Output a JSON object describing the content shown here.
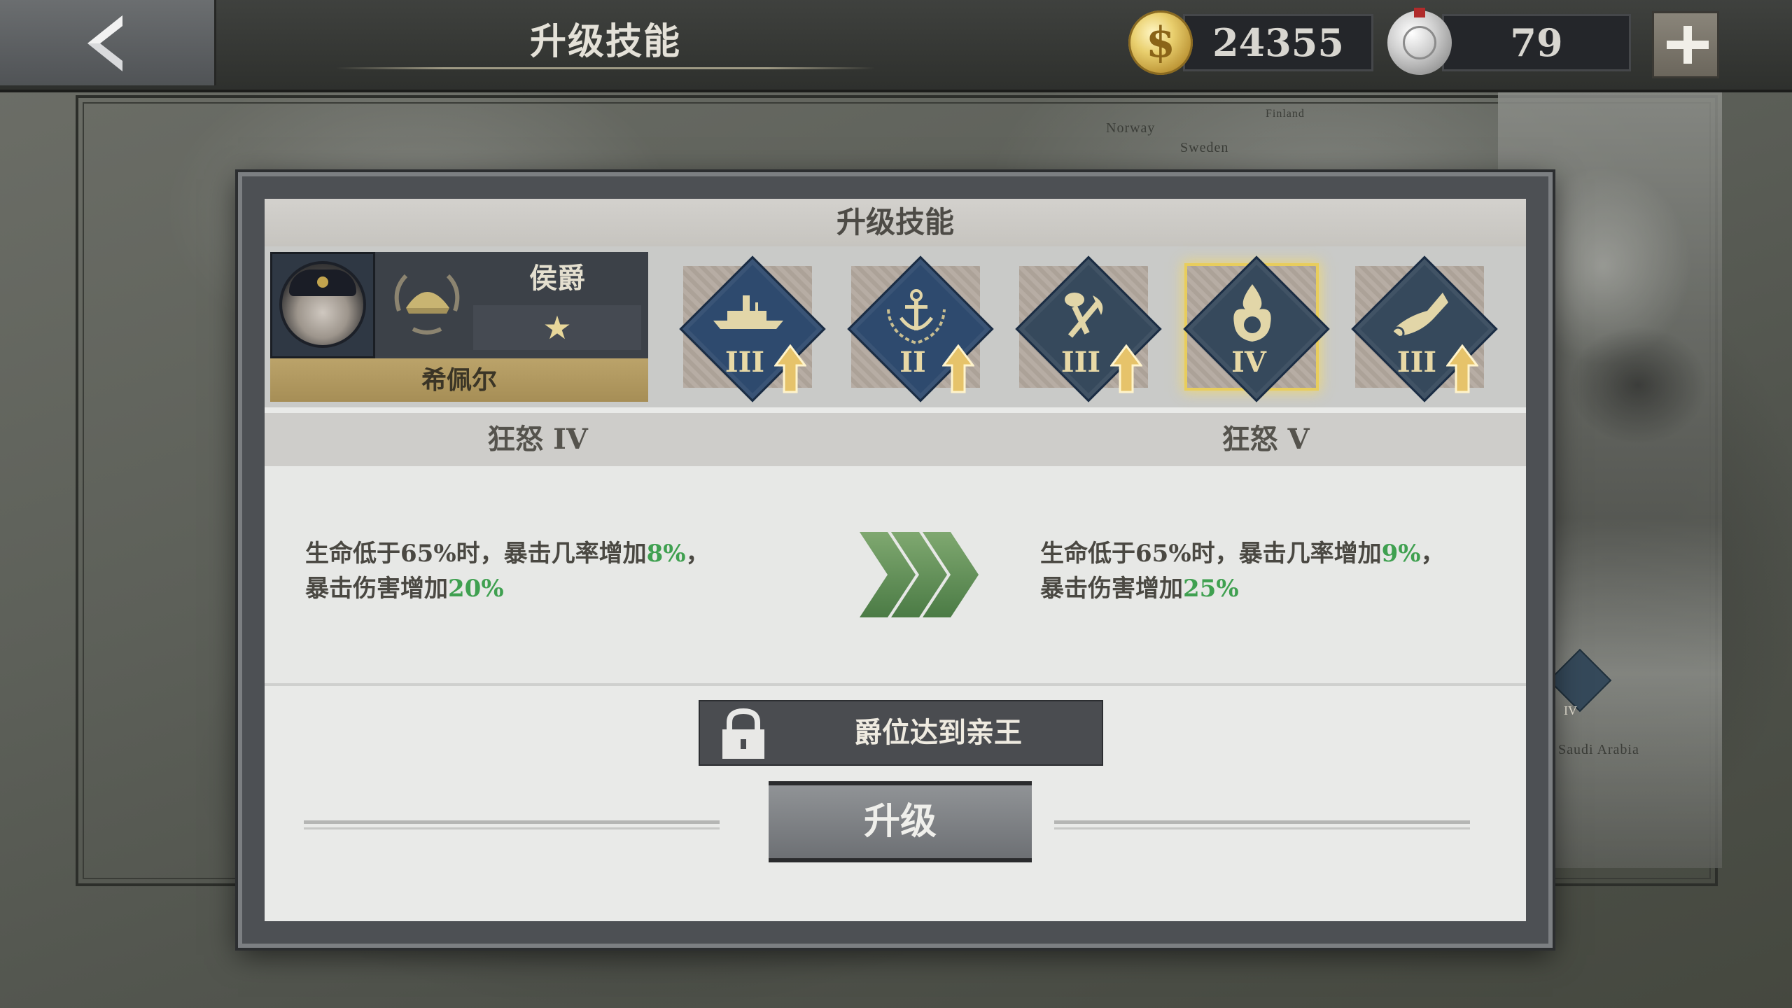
{
  "header": {
    "title": "升级技能",
    "gold": "24355",
    "medals": "79"
  },
  "map": {
    "labels": [
      "Norway",
      "Sweden",
      "Finland",
      "Saudi Arabia"
    ],
    "side_badge_level": "IV"
  },
  "dialog": {
    "title": "升级技能",
    "hero": {
      "rank": "侯爵",
      "stars": "★",
      "name": "希佩尔"
    },
    "skills": [
      {
        "icon": "battleship-icon",
        "level": "III",
        "upgradable": true
      },
      {
        "icon": "anchor-icon",
        "level": "II",
        "upgradable": true
      },
      {
        "icon": "repair-icon",
        "level": "III",
        "upgradable": true
      },
      {
        "icon": "fury-icon",
        "level": "IV",
        "upgradable": false,
        "selected": true
      },
      {
        "icon": "bugle-icon",
        "level": "III",
        "upgradable": true
      }
    ],
    "current": {
      "name": "狂怒 IV",
      "line1_prefix": "生命低于65%时，暴击几率增加",
      "line1_value": "8%",
      "line1_suffix": "，",
      "line2_prefix": "暴击伤害增加",
      "line2_value": "20%"
    },
    "next": {
      "name": "狂怒 V",
      "line1_prefix": "生命低于65%时，暴击几率增加",
      "line1_value": "9%",
      "line1_suffix": "，",
      "line2_prefix": "暴击伤害增加",
      "line2_value": "25%"
    },
    "requirement": "爵位达到亲王",
    "upgrade_label": "升级"
  },
  "colors": {
    "highlight": "#3fa050",
    "gold_text": "#e8d9a6",
    "skill_blue": "#2e4a6e",
    "selected_glow": "#e8cd5c"
  }
}
